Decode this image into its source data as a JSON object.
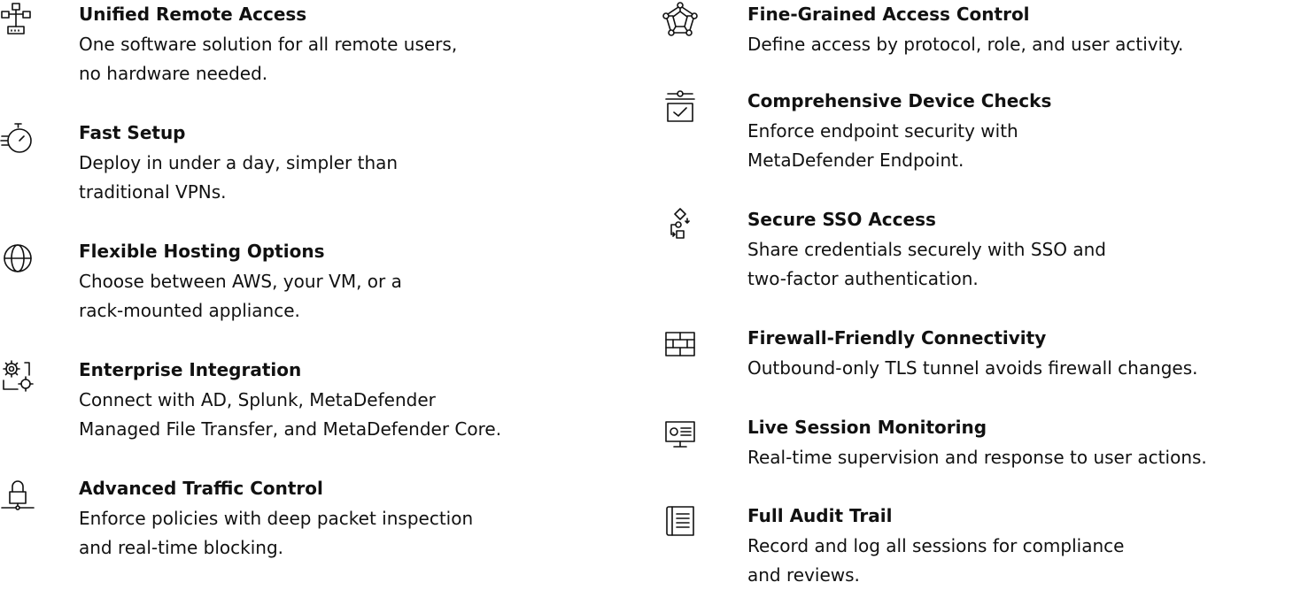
{
  "features_left": [
    {
      "icon": "network-icon",
      "title": "Unified Remote Access",
      "description": "One software solution for all remote users,\nno hardware needed."
    },
    {
      "icon": "stopwatch-icon",
      "title": "Fast Setup",
      "description": "Deploy in under a day, simpler than\ntraditional VPNs."
    },
    {
      "icon": "globe-icon",
      "title": "Flexible Hosting Options",
      "description": "Choose between AWS, your VM, or a\nrack-mounted appliance."
    },
    {
      "icon": "gears-icon",
      "title": "Enterprise Integration",
      "description": "Connect with AD, Splunk, MetaDefender\nManaged File Transfer, and MetaDefender Core."
    },
    {
      "icon": "lock-icon",
      "title": "Advanced Traffic Control",
      "description": "Enforce policies with deep packet inspection\nand real-time blocking."
    }
  ],
  "features_right": [
    {
      "icon": "polygon-network-icon",
      "title": "Fine-Grained Access Control",
      "description": "Define access by protocol, role, and user activity."
    },
    {
      "icon": "device-check-icon",
      "title": "Comprehensive Device Checks",
      "description": "Enforce endpoint security with\nMetaDefender Endpoint."
    },
    {
      "icon": "workflow-icon",
      "title": "Secure SSO Access",
      "description": "Share credentials securely with SSO and\ntwo-factor authentication."
    },
    {
      "icon": "firewall-icon",
      "title": "Firewall-Friendly Connectivity",
      "description": "Outbound-only TLS tunnel avoids firewall changes."
    },
    {
      "icon": "monitor-icon",
      "title": "Live Session Monitoring",
      "description": "Real-time supervision and response to user actions."
    },
    {
      "icon": "document-list-icon",
      "title": "Full Audit Trail",
      "description": "Record and log all sessions for compliance\nand reviews."
    }
  ]
}
